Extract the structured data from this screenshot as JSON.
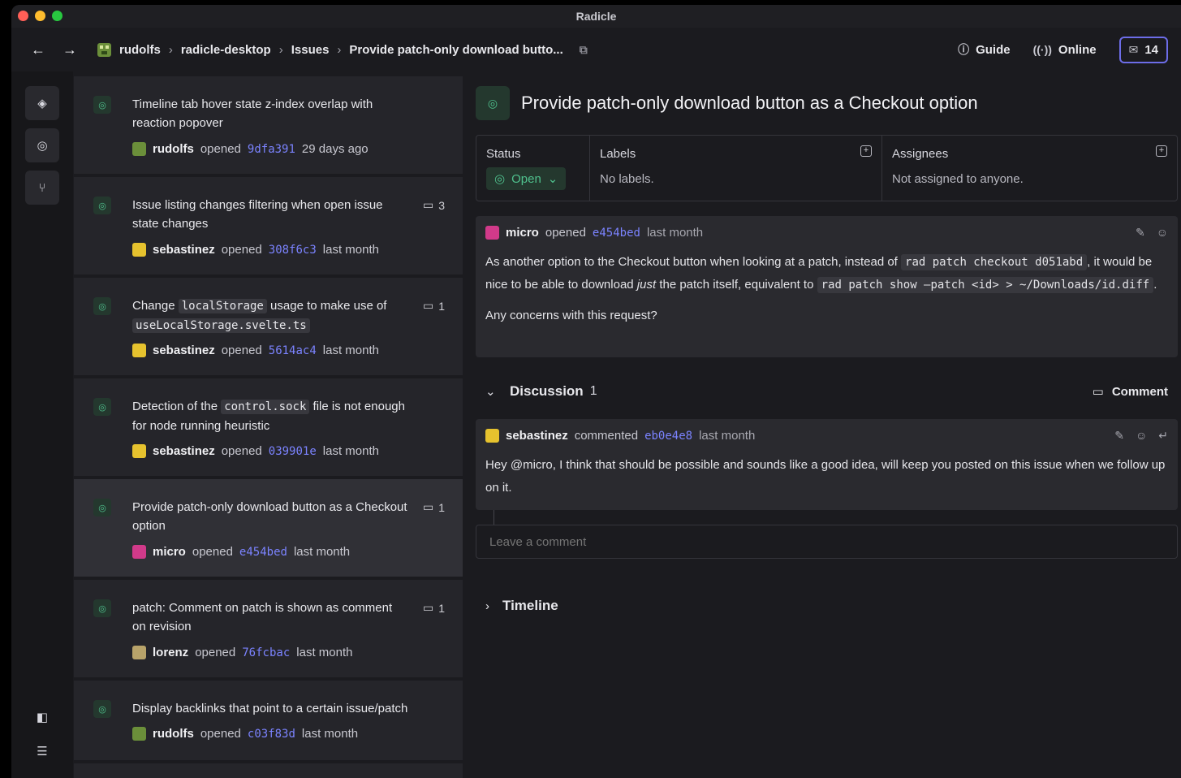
{
  "window": {
    "title": "Radicle"
  },
  "header": {
    "back_icon": "arrow-left-icon",
    "forward_icon": "arrow-right-icon",
    "breadcrumb": [
      "rudolfs",
      "radicle-desktop",
      "Issues",
      "Provide patch-only download butto..."
    ],
    "guide_label": "Guide",
    "online_label": "Online",
    "inbox_count": "14"
  },
  "rail": {
    "items": [
      "layers-icon",
      "issues-icon",
      "patches-icon"
    ],
    "bottom": [
      "sidebar-toggle-icon",
      "settings-sliders-icon"
    ]
  },
  "issues": [
    {
      "title": "Timeline tab hover state z-index overlap with reaction popover",
      "author": "rudolfs",
      "verb": "opened",
      "hash": "9dfa391",
      "time": "29 days ago",
      "comments": ""
    },
    {
      "title": "Issue listing changes filtering when open issue state changes",
      "author": "sebastinez",
      "verb": "opened",
      "hash": "308f6c3",
      "time": "last month",
      "comments": "3"
    },
    {
      "title_parts": [
        "Change ",
        "localStorage",
        " usage to make use of ",
        "useLocalStorage.svelte.ts"
      ],
      "author": "sebastinez",
      "verb": "opened",
      "hash": "5614ac4",
      "time": "last month",
      "comments": "1"
    },
    {
      "title_parts": [
        "Detection of the ",
        "control.sock",
        " file is not enough for node running heuristic"
      ],
      "author": "sebastinez",
      "verb": "opened",
      "hash": "039901e",
      "time": "last month",
      "comments": ""
    },
    {
      "title": "Provide patch-only download button as a Checkout option",
      "author": "micro",
      "verb": "opened",
      "hash": "e454bed",
      "time": "last month",
      "comments": "1"
    },
    {
      "title": "patch: Comment on patch is shown as comment on revision",
      "author": "lorenz",
      "verb": "opened",
      "hash": "76fcbac",
      "time": "last month",
      "comments": "1"
    },
    {
      "title": "Display backlinks that point to a certain issue/patch",
      "author": "rudolfs",
      "verb": "opened",
      "hash": "c03f83d",
      "time": "last month",
      "comments": ""
    }
  ],
  "issue": {
    "title": "Provide patch-only download button as a Checkout option",
    "status_label": "Status",
    "status_value": "Open",
    "labels_label": "Labels",
    "labels_value": "No labels.",
    "assignees_label": "Assignees",
    "assignees_value": "Not assigned to anyone.",
    "body": {
      "author": "micro",
      "verb": "opened",
      "hash": "e454bed",
      "time": "last month",
      "p1_a": "As another option to the Checkout button when looking at a patch, instead of ",
      "p1_code1": "rad patch checkout d051abd",
      "p1_b": ", it would be nice to be able to download ",
      "p1_em": "just",
      "p1_c": " the patch itself, equivalent to ",
      "p1_code2": "rad patch show —patch <id> > ~/Downloads/id.diff",
      "p1_d": ".",
      "p2": "Any concerns with this request?"
    },
    "discussion": {
      "label": "Discussion",
      "count": "1",
      "comment_button": "Comment",
      "comments": [
        {
          "author": "sebastinez",
          "verb": "commented",
          "hash": "eb0e4e8",
          "time": "last month",
          "text": "Hey @micro, I think that should be possible and sounds like a good idea, will keep you posted on this issue when we follow up on it."
        }
      ],
      "leave_placeholder": "Leave a comment"
    },
    "timeline_label": "Timeline"
  },
  "colors": {
    "accent": "#6d6de8",
    "open_green": "#4fc08d",
    "hash_blue": "#7b83ff"
  }
}
